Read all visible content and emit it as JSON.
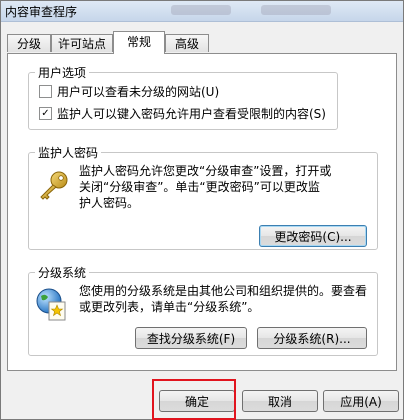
{
  "window": {
    "title": "内容审查程序"
  },
  "tabs": [
    "分级",
    "许可站点",
    "常规",
    "高级"
  ],
  "active_tab_index": 2,
  "user_options": {
    "title": "用户选项",
    "checkbox1": {
      "label": "用户可以查看未分级的网站(U)",
      "checked": false
    },
    "checkbox2": {
      "label": "监护人可以键入密码允许用户查看受限制的内容(S)",
      "checked": true
    }
  },
  "guardian_password": {
    "title": "监护人密码",
    "line1": "监护人密码允许您更改“分级审查”设置，打开或",
    "line2": "关闭“分级审查”。单击“更改密码”可以更改监",
    "line3": "护人密码。",
    "icon": "key-icon",
    "change_button": "更改密码(C)..."
  },
  "rating_system": {
    "title": "分级系统",
    "line1": "您使用的分级系统是由其他公司和组织提供的。要查看",
    "line2": "或更改列表，请单击“分级系统”。",
    "icon": "globe-certificate-icon",
    "find_button": "查找分级系统(F)",
    "systems_button": "分级系统(R)..."
  },
  "footer": {
    "ok_button": "确定",
    "cancel_button": "取消",
    "apply_button": "应用(A)"
  },
  "colors": {
    "highlight": "#e1141e"
  }
}
